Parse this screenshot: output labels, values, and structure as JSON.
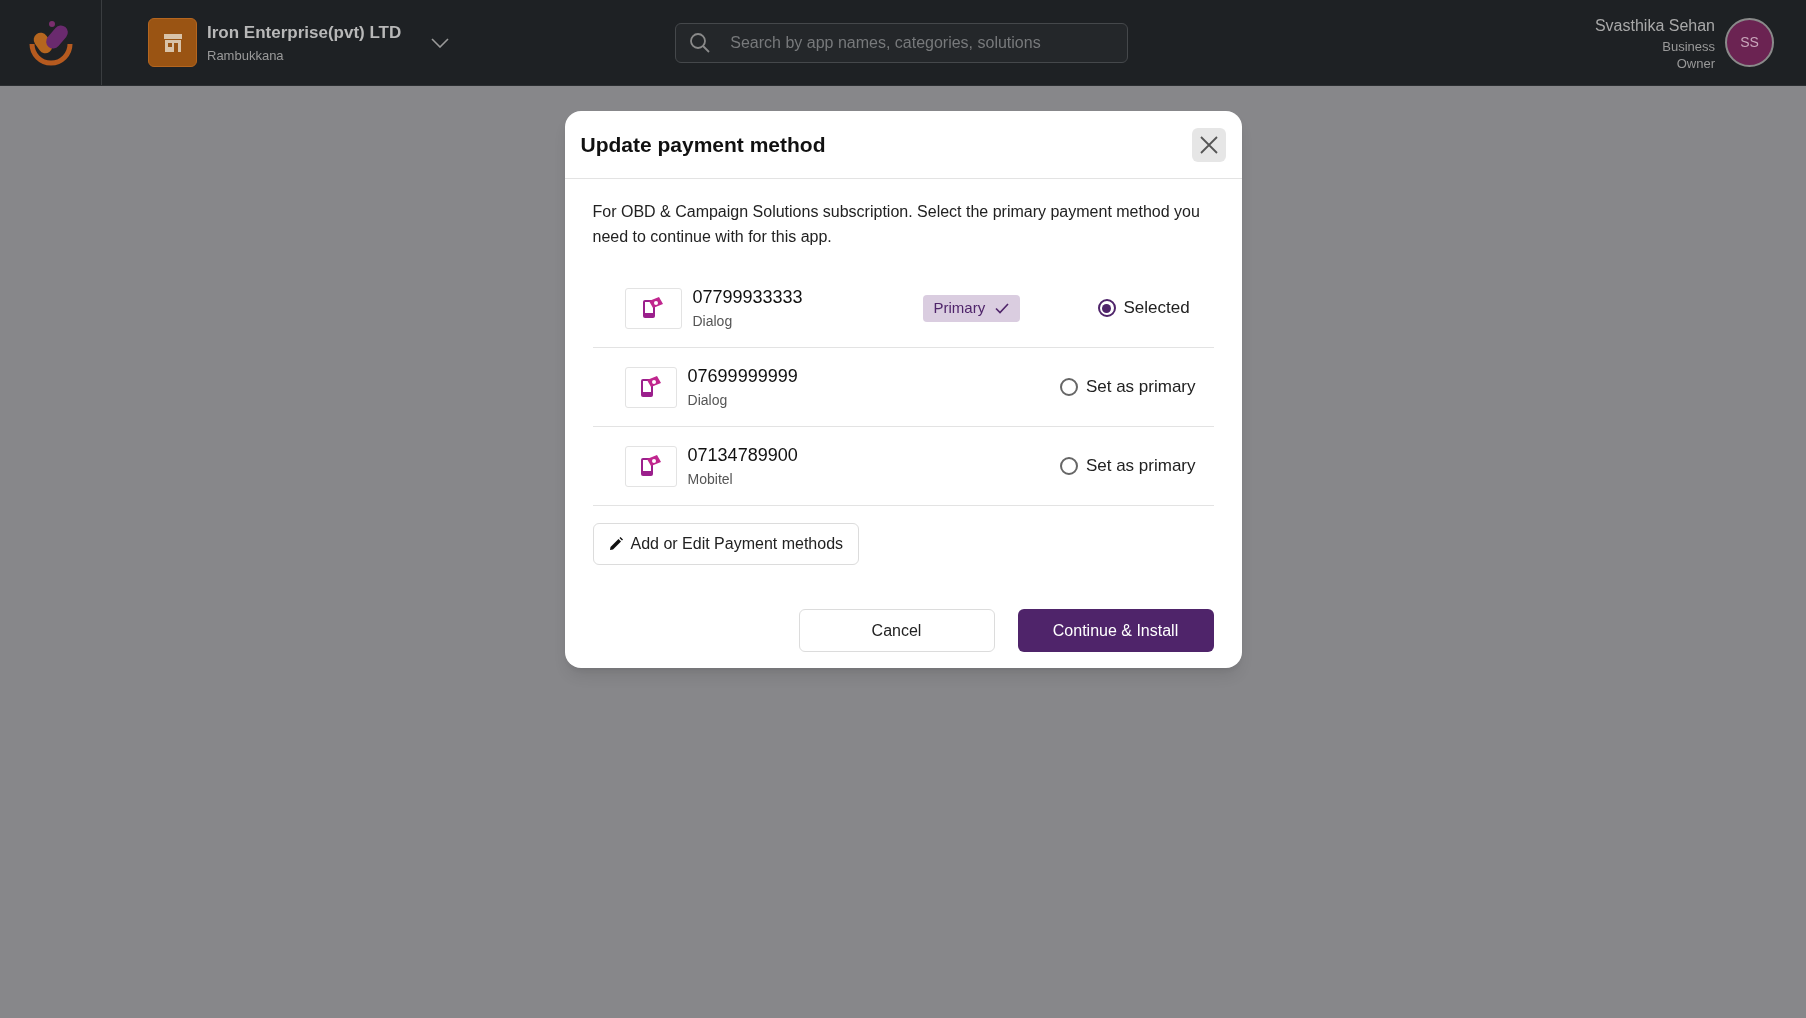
{
  "header": {
    "company": "Iron Enterprise(pvt) LTD",
    "location": "Rambukkana",
    "search": {
      "placeholder": "Search by app names, categories, solutions"
    },
    "user": {
      "name": "Svasthika Sehan",
      "role": "Business Owner",
      "initials": "SS"
    }
  },
  "dialog": {
    "title": "Update payment method",
    "description": "For OBD & Campaign Solutions subscription. Select the primary payment method you need to continue with for this app.",
    "methods": [
      {
        "number": "07799933333",
        "provider": "Dialog",
        "badge": "Primary",
        "selected": true,
        "option": "Selected"
      },
      {
        "number": "07699999999",
        "provider": "Dialog",
        "selected": false,
        "option": "Set as primary"
      },
      {
        "number": "07134789900",
        "provider": "Mobitel",
        "selected": false,
        "option": "Set as primary"
      }
    ],
    "edit_button": "Add or Edit Payment methods",
    "cancel_button": "Cancel",
    "confirm_button": "Continue & Install"
  }
}
